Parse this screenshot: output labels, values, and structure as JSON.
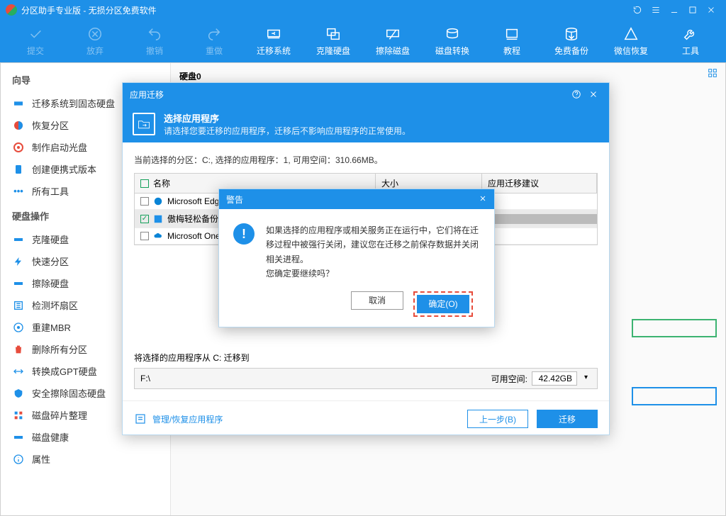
{
  "title": "分区助手专业版 - 无损分区免费软件",
  "toolbar": {
    "commit": "提交",
    "discard": "放弃",
    "undo": "撤销",
    "redo": "重做",
    "migrate_os": "迁移系统",
    "clone_disk": "克隆硬盘",
    "wipe_disk": "擦除磁盘",
    "convert_disk": "磁盘转换",
    "tutorial": "教程",
    "free_backup": "免费备份",
    "wechat_recover": "微信恢复",
    "tools": "工具"
  },
  "sidebar": {
    "guide_header": "向导",
    "disk_ops_header": "硬盘操作",
    "guide_items": [
      {
        "label": "迁移系统到固态硬盘"
      },
      {
        "label": "恢复分区"
      },
      {
        "label": "制作启动光盘"
      },
      {
        "label": "创建便携式版本"
      },
      {
        "label": "所有工具"
      }
    ],
    "disk_items": [
      {
        "label": "克隆硬盘"
      },
      {
        "label": "快速分区"
      },
      {
        "label": "擦除硬盘"
      },
      {
        "label": "检测坏扇区"
      },
      {
        "label": "重建MBR"
      },
      {
        "label": "删除所有分区"
      },
      {
        "label": "转换成GPT硬盘"
      },
      {
        "label": "安全擦除固态硬盘"
      },
      {
        "label": "磁盘碎片整理"
      },
      {
        "label": "磁盘健康"
      },
      {
        "label": "属性"
      }
    ]
  },
  "content": {
    "disk0": "硬盘0"
  },
  "modal1": {
    "title": "应用迁移",
    "banner_title": "选择应用程序",
    "banner_sub": "请选择您要迁移的应用程序，迁移后不影响应用程序的正常使用。",
    "info": "当前选择的分区：C:, 选择的应用程序：1, 可用空间：310.66MB。",
    "col_name": "名称",
    "col_size": "大小",
    "col_suggest": "应用迁移建议",
    "apps": [
      {
        "name": "Microsoft Edge"
      },
      {
        "name": "傲梅轻松备份免"
      },
      {
        "name": "Microsoft OneDr"
      }
    ],
    "move_label": "将选择的应用程序从 C: 迁移到",
    "path": "F:\\",
    "free_label": "可用空间:",
    "free_size": "42.42GB",
    "manage": "管理/恢复应用程序",
    "back": "上一步(B)",
    "migrate": "迁移"
  },
  "modal2": {
    "title": "警告",
    "msg1": "如果选择的应用程序或相关服务正在运行中，它们将在迁移过程中被强行关闭，建议您在迁移之前保存数据并关闭相关进程。",
    "msg2": "您确定要继续吗？",
    "cancel": "取消",
    "ok": "确定(O)"
  }
}
